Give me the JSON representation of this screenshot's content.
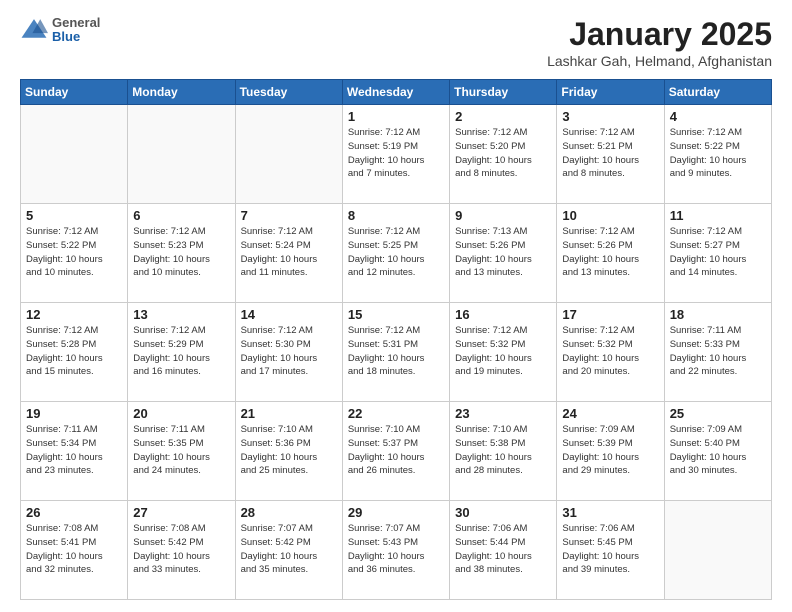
{
  "header": {
    "logo_general": "General",
    "logo_blue": "Blue",
    "title": "January 2025",
    "subtitle": "Lashkar Gah, Helmand, Afghanistan"
  },
  "days_of_week": [
    "Sunday",
    "Monday",
    "Tuesday",
    "Wednesday",
    "Thursday",
    "Friday",
    "Saturday"
  ],
  "weeks": [
    [
      {
        "day": "",
        "info": ""
      },
      {
        "day": "",
        "info": ""
      },
      {
        "day": "",
        "info": ""
      },
      {
        "day": "1",
        "info": "Sunrise: 7:12 AM\nSunset: 5:19 PM\nDaylight: 10 hours\nand 7 minutes."
      },
      {
        "day": "2",
        "info": "Sunrise: 7:12 AM\nSunset: 5:20 PM\nDaylight: 10 hours\nand 8 minutes."
      },
      {
        "day": "3",
        "info": "Sunrise: 7:12 AM\nSunset: 5:21 PM\nDaylight: 10 hours\nand 8 minutes."
      },
      {
        "day": "4",
        "info": "Sunrise: 7:12 AM\nSunset: 5:22 PM\nDaylight: 10 hours\nand 9 minutes."
      }
    ],
    [
      {
        "day": "5",
        "info": "Sunrise: 7:12 AM\nSunset: 5:22 PM\nDaylight: 10 hours\nand 10 minutes."
      },
      {
        "day": "6",
        "info": "Sunrise: 7:12 AM\nSunset: 5:23 PM\nDaylight: 10 hours\nand 10 minutes."
      },
      {
        "day": "7",
        "info": "Sunrise: 7:12 AM\nSunset: 5:24 PM\nDaylight: 10 hours\nand 11 minutes."
      },
      {
        "day": "8",
        "info": "Sunrise: 7:12 AM\nSunset: 5:25 PM\nDaylight: 10 hours\nand 12 minutes."
      },
      {
        "day": "9",
        "info": "Sunrise: 7:13 AM\nSunset: 5:26 PM\nDaylight: 10 hours\nand 13 minutes."
      },
      {
        "day": "10",
        "info": "Sunrise: 7:12 AM\nSunset: 5:26 PM\nDaylight: 10 hours\nand 13 minutes."
      },
      {
        "day": "11",
        "info": "Sunrise: 7:12 AM\nSunset: 5:27 PM\nDaylight: 10 hours\nand 14 minutes."
      }
    ],
    [
      {
        "day": "12",
        "info": "Sunrise: 7:12 AM\nSunset: 5:28 PM\nDaylight: 10 hours\nand 15 minutes."
      },
      {
        "day": "13",
        "info": "Sunrise: 7:12 AM\nSunset: 5:29 PM\nDaylight: 10 hours\nand 16 minutes."
      },
      {
        "day": "14",
        "info": "Sunrise: 7:12 AM\nSunset: 5:30 PM\nDaylight: 10 hours\nand 17 minutes."
      },
      {
        "day": "15",
        "info": "Sunrise: 7:12 AM\nSunset: 5:31 PM\nDaylight: 10 hours\nand 18 minutes."
      },
      {
        "day": "16",
        "info": "Sunrise: 7:12 AM\nSunset: 5:32 PM\nDaylight: 10 hours\nand 19 minutes."
      },
      {
        "day": "17",
        "info": "Sunrise: 7:12 AM\nSunset: 5:32 PM\nDaylight: 10 hours\nand 20 minutes."
      },
      {
        "day": "18",
        "info": "Sunrise: 7:11 AM\nSunset: 5:33 PM\nDaylight: 10 hours\nand 22 minutes."
      }
    ],
    [
      {
        "day": "19",
        "info": "Sunrise: 7:11 AM\nSunset: 5:34 PM\nDaylight: 10 hours\nand 23 minutes."
      },
      {
        "day": "20",
        "info": "Sunrise: 7:11 AM\nSunset: 5:35 PM\nDaylight: 10 hours\nand 24 minutes."
      },
      {
        "day": "21",
        "info": "Sunrise: 7:10 AM\nSunset: 5:36 PM\nDaylight: 10 hours\nand 25 minutes."
      },
      {
        "day": "22",
        "info": "Sunrise: 7:10 AM\nSunset: 5:37 PM\nDaylight: 10 hours\nand 26 minutes."
      },
      {
        "day": "23",
        "info": "Sunrise: 7:10 AM\nSunset: 5:38 PM\nDaylight: 10 hours\nand 28 minutes."
      },
      {
        "day": "24",
        "info": "Sunrise: 7:09 AM\nSunset: 5:39 PM\nDaylight: 10 hours\nand 29 minutes."
      },
      {
        "day": "25",
        "info": "Sunrise: 7:09 AM\nSunset: 5:40 PM\nDaylight: 10 hours\nand 30 minutes."
      }
    ],
    [
      {
        "day": "26",
        "info": "Sunrise: 7:08 AM\nSunset: 5:41 PM\nDaylight: 10 hours\nand 32 minutes."
      },
      {
        "day": "27",
        "info": "Sunrise: 7:08 AM\nSunset: 5:42 PM\nDaylight: 10 hours\nand 33 minutes."
      },
      {
        "day": "28",
        "info": "Sunrise: 7:07 AM\nSunset: 5:42 PM\nDaylight: 10 hours\nand 35 minutes."
      },
      {
        "day": "29",
        "info": "Sunrise: 7:07 AM\nSunset: 5:43 PM\nDaylight: 10 hours\nand 36 minutes."
      },
      {
        "day": "30",
        "info": "Sunrise: 7:06 AM\nSunset: 5:44 PM\nDaylight: 10 hours\nand 38 minutes."
      },
      {
        "day": "31",
        "info": "Sunrise: 7:06 AM\nSunset: 5:45 PM\nDaylight: 10 hours\nand 39 minutes."
      },
      {
        "day": "",
        "info": ""
      }
    ]
  ]
}
